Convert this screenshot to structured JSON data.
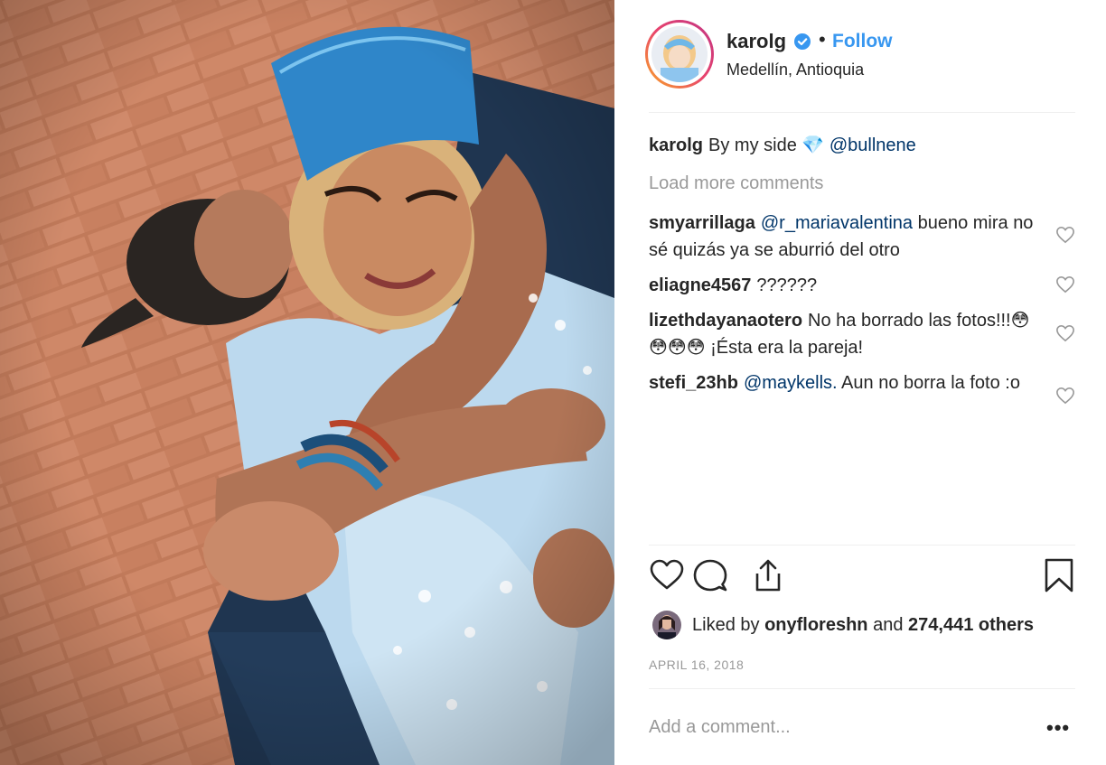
{
  "post": {
    "username": "karolg",
    "follow_label": "Follow",
    "separator": "•",
    "location": "Medellín, Antioquia"
  },
  "caption": {
    "username": "karolg",
    "text": "By my side 💎",
    "mention": "@bullnene"
  },
  "load_more_label": "Load more comments",
  "comments": [
    {
      "username": "smyarrillaga",
      "mention": "@r_mariavalentina",
      "text": " bueno mira no sé quizás ya se aburrió del otro"
    },
    {
      "username": "eliagne4567",
      "mention": "",
      "text": "??????"
    },
    {
      "username": "lizethdayanaotero",
      "mention": "",
      "text": "No ha borrado las fotos!!!😳 😳😳😳 ¡Ésta era la pareja!"
    },
    {
      "username": "stefi_23hb",
      "mention": "@maykells.",
      "text": " Aun no borra la foto :o"
    }
  ],
  "likes": {
    "prefix": "Liked by",
    "liker": "onyfloreshn",
    "and": "and",
    "count_text": "274,441 others"
  },
  "date": "APRIL 16, 2018",
  "add_comment_placeholder": "Add a comment...",
  "more_label": "•••",
  "colors": {
    "accent": "#3897f0",
    "muted": "#999999",
    "text": "#262626",
    "mention": "#003569"
  },
  "icons": [
    "verified-badge-icon",
    "heart-icon",
    "comment-icon",
    "share-icon",
    "bookmark-icon",
    "more-options-icon"
  ]
}
